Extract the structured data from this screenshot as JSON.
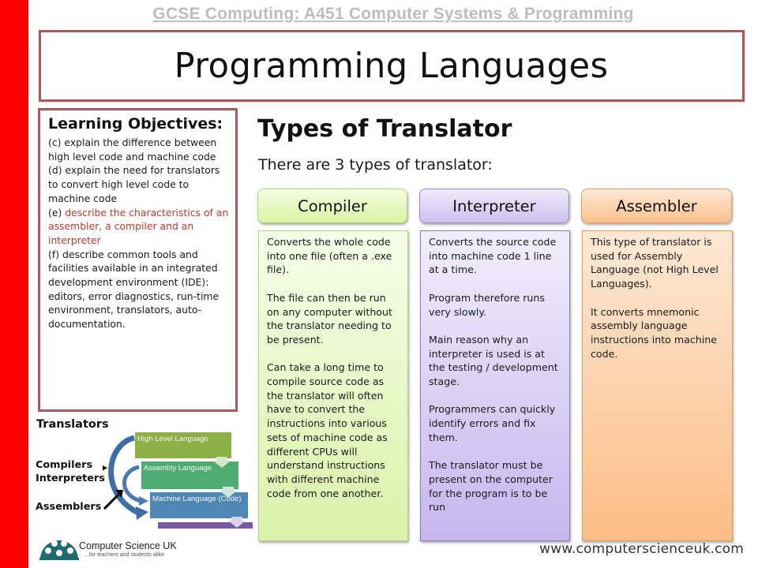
{
  "course_title": "GCSE Computing: A451 Computer Systems & Programming",
  "slide_title": "Programming Languages",
  "objectives": {
    "heading": "Learning Objectives:",
    "items": [
      {
        "text": "(c) explain the difference between high level code and machine code",
        "highlight": false
      },
      {
        "text": "(d) explain the need for translators to convert high level code to machine code",
        "highlight": false
      },
      {
        "prefix": "(e) ",
        "text": "describe the characteristics of an assembler, a compiler and an interpreter",
        "highlight": true
      },
      {
        "text": "(f) describe common tools and facilities available in an integrated development environment (IDE): editors, error diagnostics, run-time environment, translators, auto-documentation.",
        "highlight": false
      }
    ]
  },
  "main": {
    "heading": "Types of Translator",
    "intro": "There are 3 types of translator:",
    "translators": [
      {
        "name": "Compiler",
        "color": "#d9f4a4",
        "paragraphs": [
          "Converts the whole code into one file (often a .exe file).",
          "The file can then be run on any computer without the translator needing to be present.",
          "Can take a long time to compile source code as the translator will often have to convert the instructions into various sets of machine code as different CPUs will understand instructions with different machine code from one another."
        ]
      },
      {
        "name": "Interpreter",
        "color": "#cdbfef",
        "paragraphs": [
          "Converts the source code into machine code 1 line at a time.",
          "Program therefore runs very slowly.",
          "Main reason why an interpreter is used is at the testing / development stage.",
          "Programmers can quickly identify errors and fix them.",
          "The translator must be present on the computer for the program is to be run"
        ]
      },
      {
        "name": "Assembler",
        "color": "#fbc18d",
        "paragraphs": [
          "This type of translator is used for Assembly Language (not High Level Languages).",
          "It converts mnemonic assembly language instructions into machine code."
        ]
      }
    ]
  },
  "diagram": {
    "title": "Translators",
    "labels": {
      "compilers": "Compilers",
      "interpreters": "Interpreters",
      "assemblers": "Assemblers"
    },
    "levels": [
      "High Level Language",
      "Assembly Language",
      "Machine Language (Code)"
    ]
  },
  "footer": {
    "logo_name": "Computer Science UK",
    "logo_tagline": "...for teachers and students alike",
    "url": "www.computerscienceuk.com"
  },
  "colors": {
    "accent_red": "#ff0000",
    "border": "#a85a5a",
    "highlight_text": "#c0392b",
    "logo_teal": "#1e6b6e"
  }
}
